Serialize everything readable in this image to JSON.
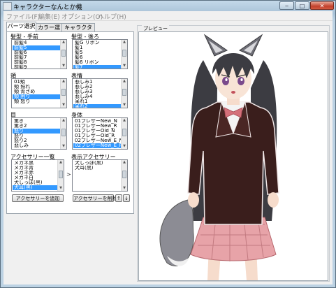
{
  "window": {
    "title": "キャラクターなんとか機",
    "controls": {
      "minimize": "‒",
      "maximize": "□",
      "close": "✕"
    }
  },
  "menu": [
    {
      "label": "ファイル(F)"
    },
    {
      "label": "編集(E)"
    },
    {
      "label": "オプション(O)"
    },
    {
      "label": "ヘルプ(H)"
    }
  ],
  "tabs": [
    {
      "label": "パーツ選択",
      "active": true
    },
    {
      "label": "カラー選択",
      "active": false
    },
    {
      "label": "キャラクター選択",
      "active": false
    }
  ],
  "parts": {
    "front_hair": {
      "label": "髪型 - 手前",
      "items": [
        "前髪4",
        "前髪5",
        "前髪6",
        "前髪7",
        "前髪8",
        "前髪9"
      ],
      "selected": "前髪5"
    },
    "back_hair": {
      "label": "髪型 - 後ろ",
      "items": [
        "髪G リボン",
        "髪1",
        "髪5",
        "髪6",
        "髪6 リボン",
        "髪7"
      ],
      "selected": "髪7"
    },
    "cheeks": {
      "label": "頬",
      "items": [
        "01頬",
        "頬 照れ",
        "頬 青ざめ",
        "頬 困り",
        "頬 怒り"
      ],
      "selected": "頬 困り"
    },
    "expression": {
      "label": "表情",
      "items": [
        "悲しみ1",
        "悲しみ2",
        "悲しみ3",
        "悲しみ4",
        "呆れ1",
        "呆れ2"
      ],
      "selected": "呆れ2"
    },
    "eyes": {
      "label": "目",
      "items": [
        "驚き",
        "驚き2",
        "怒り",
        "怒り",
        "怒り2",
        "悲しみ"
      ],
      "selected": "怒り"
    },
    "body": {
      "label": "身体",
      "items": [
        "01ブレザーNew_N",
        "01ブレザーNew_R",
        "01ブレザーOld_N",
        "01ブレザーOld_R",
        "02ブレザーNew_E_N",
        "02ブレザーNew_E_R"
      ],
      "selected": "02ブレザーNew_E_R"
    },
    "accessory_list": {
      "label": "アクセサリー一覧",
      "items": [
        "メガネ黒",
        "メガネ青",
        "メガネ赤",
        "メガネ白",
        "犬しっぽ(黒)",
        "犬耳(黒)"
      ],
      "selected": "犬耳(黒)"
    },
    "shown_accessories": {
      "label": "表示アクセサリー",
      "items": [
        "犬しっぽ(黒)",
        "犬耳(黒)"
      ],
      "selected": ""
    }
  },
  "buttons": {
    "add_accessory": "アクセサリーを追加",
    "remove_accessory": "アクセサリーを削除",
    "move_up": "↑",
    "move_down": "↓",
    "transfer": ">"
  },
  "preview": {
    "label": "プレビュー"
  },
  "colors": {
    "selection": "#3399ff",
    "hair": "#3c3c42",
    "blazer": "#3a1e1c",
    "skirt": "#e7a3a8",
    "ribbon": "#d4707a"
  }
}
